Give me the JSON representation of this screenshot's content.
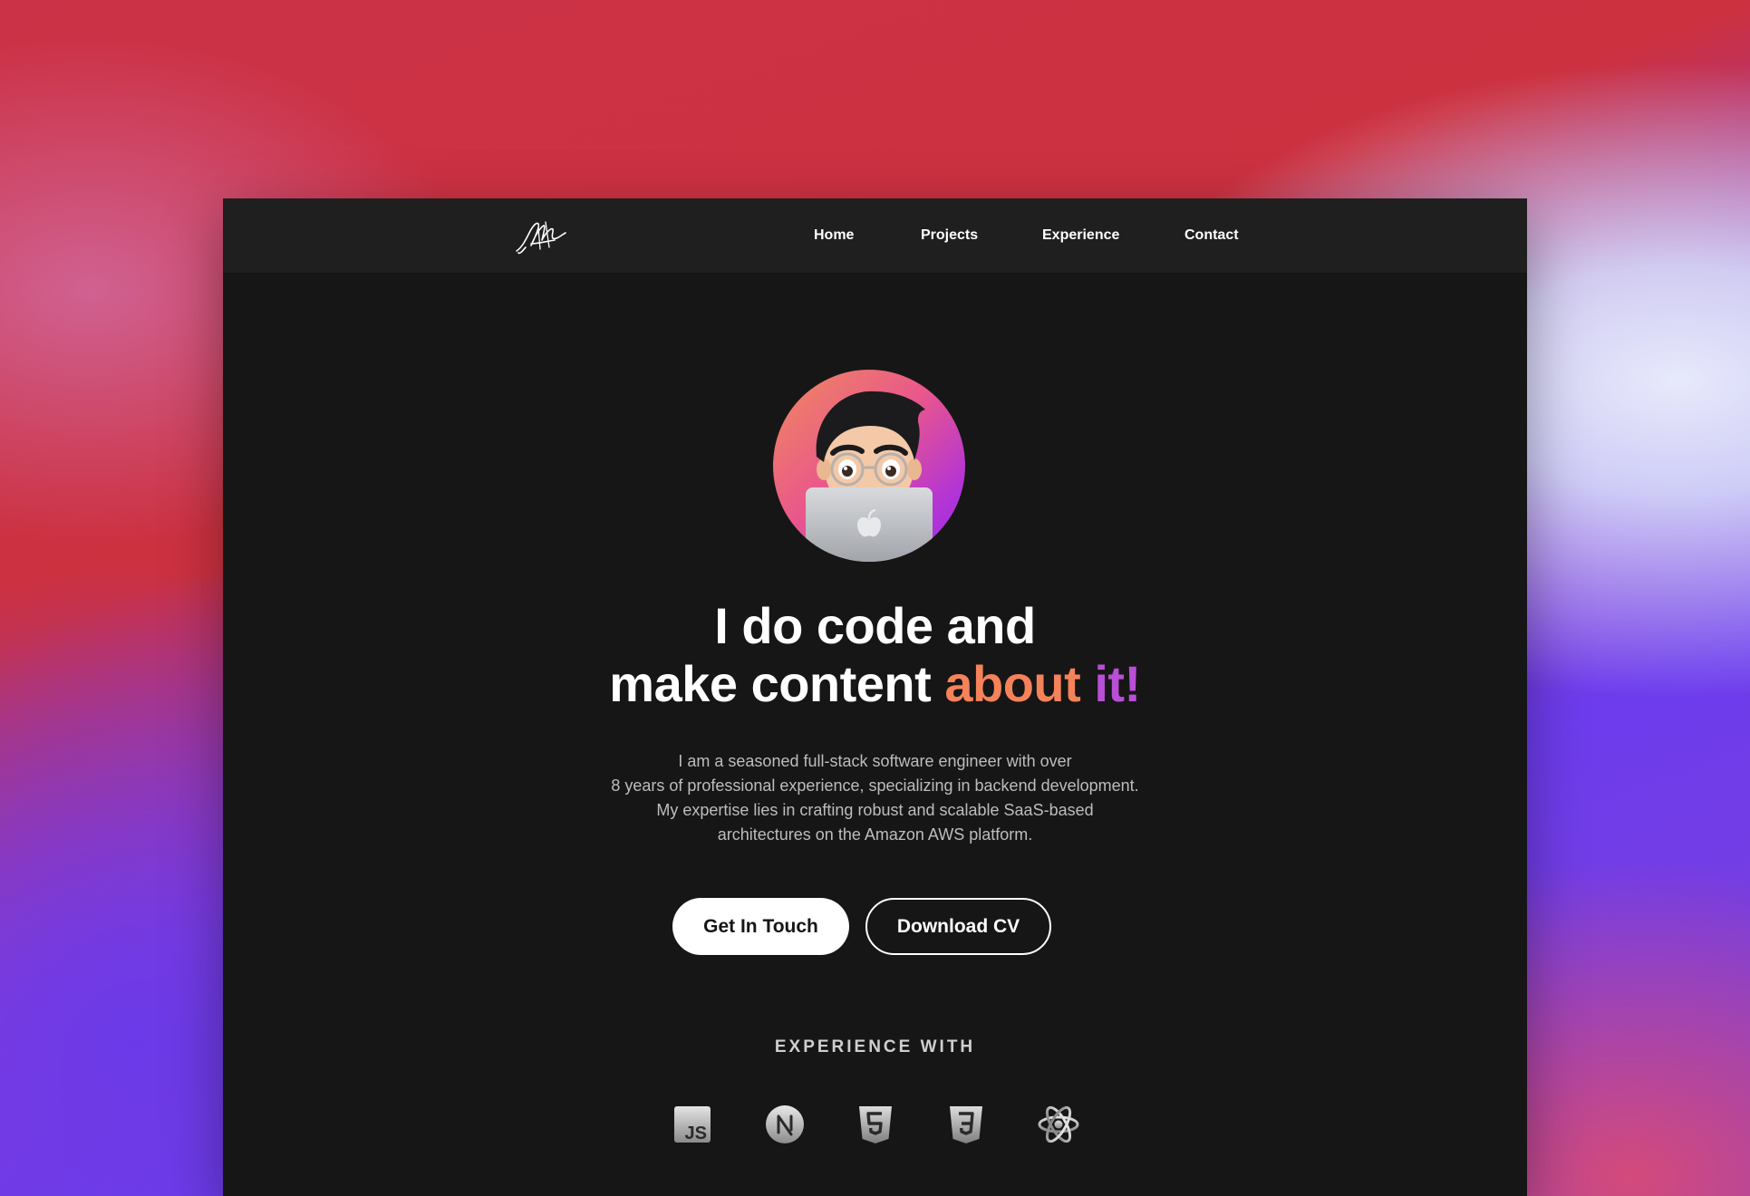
{
  "nav": {
    "logo_alt": "signature logo",
    "links": [
      "Home",
      "Projects",
      "Experience",
      "Contact"
    ]
  },
  "hero": {
    "line1": "I do code and",
    "line2": "make content",
    "accent_a": "about",
    "accent_b": "it!",
    "description": [
      "I am a seasoned full-stack software engineer with over",
      "8 years of professional experience, specializing in backend development.",
      "My expertise lies in crafting robust and scalable SaaS-based",
      "architectures on the Amazon AWS platform."
    ],
    "primary_button": "Get In Touch",
    "secondary_button": "Download CV"
  },
  "experience": {
    "title": "EXPERIENCE WITH",
    "icons": [
      "javascript-icon",
      "nextjs-icon",
      "html5-icon",
      "css3-icon",
      "react-icon"
    ]
  },
  "colors": {
    "window_bg": "#161616",
    "navbar_bg": "#1f1f1f",
    "accent_orange": "#f6825a",
    "accent_purple": "#b94ed7"
  }
}
